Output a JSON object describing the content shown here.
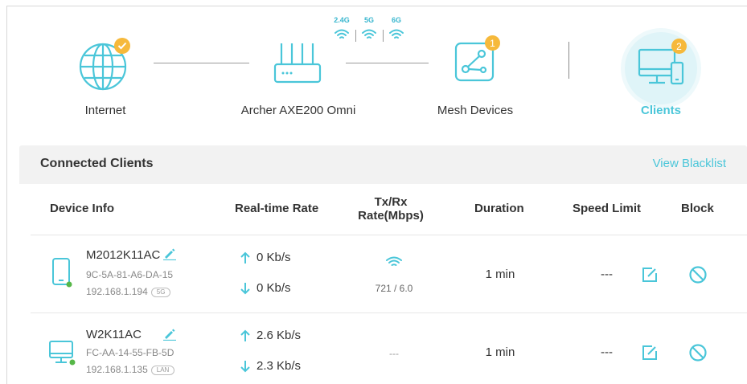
{
  "topology": {
    "internet": {
      "label": "Internet"
    },
    "router": {
      "label": "Archer AXE200 Omni",
      "bands": [
        "2.4G",
        "5G",
        "6G"
      ]
    },
    "mesh": {
      "label": "Mesh Devices",
      "count": "1"
    },
    "clients": {
      "label": "Clients",
      "count": "2"
    }
  },
  "colors": {
    "accent": "#4ac6d9",
    "badge": "#f6b93b",
    "online_dot": "#56b748"
  },
  "panel": {
    "title": "Connected Clients",
    "blacklist_link": "View Blacklist"
  },
  "table": {
    "headers": {
      "device_info": "Device Info",
      "realtime_rate": "Real-time Rate",
      "txrx_line1": "Tx/Rx",
      "txrx_line2": "Rate(Mbps)",
      "duration": "Duration",
      "speed_limit": "Speed Limit",
      "block": "Block"
    },
    "rows": [
      {
        "name": "M2012K11AC",
        "mac": "9C-5A-81-A6-DA-15",
        "ip": "192.168.1.194",
        "connection": "5G",
        "device_icon": "phone-icon",
        "up_rate": "0 Kb/s",
        "down_rate": "0 Kb/s",
        "txrx": "721 / 6.0",
        "duration": "1 min",
        "speed_limit": "---"
      },
      {
        "name": "W2K11AC",
        "mac": "FC-AA-14-55-FB-5D",
        "ip": "192.168.1.135",
        "connection": "LAN",
        "device_icon": "desktop-icon",
        "up_rate": "2.6 Kb/s",
        "down_rate": "2.3 Kb/s",
        "txrx": "---",
        "duration": "1 min",
        "speed_limit": "---"
      }
    ]
  }
}
